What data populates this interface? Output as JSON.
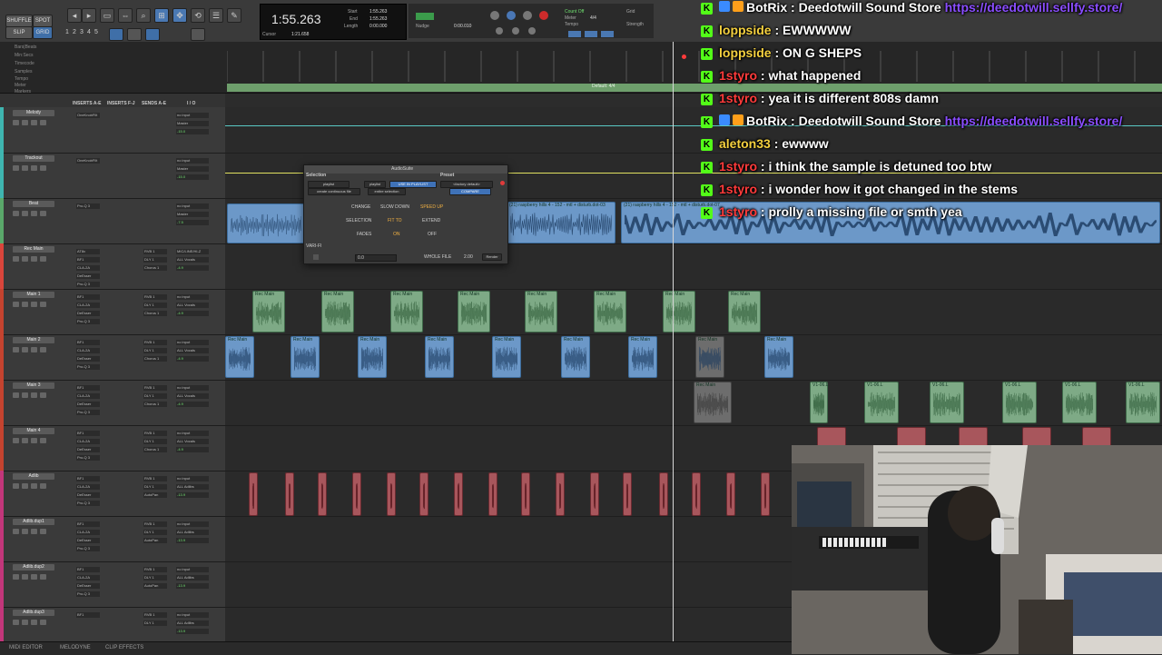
{
  "toolbar": {
    "mode_buttons": [
      "SHUFFLE",
      "SPOT",
      "SLIP",
      "GRID"
    ],
    "number_keys": [
      "1",
      "2",
      "3",
      "4",
      "5"
    ],
    "counter_main": "1:55.263",
    "counter_labels": [
      "Start",
      "End",
      "Length"
    ],
    "counter_values": [
      "1:55.263",
      "1:55.263",
      "0:00.000"
    ],
    "cursor_label": "Cursor",
    "cursor_value": "1:21.658",
    "nudge_label": "Nudge",
    "nudge_value": "0:00.010",
    "count_off_label": "Count Off",
    "meter_label": "Meter",
    "meter_value": "4/4",
    "tempo_label": "Tempo",
    "grid_label": "Grid",
    "strength_label": "Strength"
  },
  "rulers": {
    "labels": [
      "Bars|Beats",
      "Min:Secs",
      "Timecode",
      "Samples",
      "Tempo",
      "Meter",
      "Markers"
    ],
    "tempo_text": "Default: 4/4"
  },
  "mix_header": {
    "inserts_ae": "INSERTS A-E",
    "inserts_fj": "INSERTS F-J",
    "sends_ae": "SENDS A-E",
    "io": "I / O"
  },
  "tracks": [
    {
      "name": "Melody",
      "color": "#3fb5b0",
      "inserts": [
        "OneKnobFilt"
      ],
      "sends": [],
      "io": [
        "no input",
        "Master"
      ],
      "vol": "-15.0"
    },
    {
      "name": "Trackout",
      "color": "#3fb5b0",
      "inserts": [
        "OneKnobFilt"
      ],
      "sends": [],
      "io": [
        "no input",
        "Master"
      ],
      "vol": "-15.0"
    },
    {
      "name": "Beat",
      "color": "#5aa86a",
      "inserts": [
        "Pro-Q 3"
      ],
      "sends": [],
      "io": [
        "no input",
        "Master"
      ],
      "vol": "-7.5"
    },
    {
      "name": "Rec Main",
      "color": "#d9453b",
      "inserts": [
        "AT8x",
        "BF1",
        "CLA-2A",
        "DeEsser",
        "Pro-Q 3"
      ],
      "sends": [
        "RVB 1",
        "DLY 1",
        "Chorus 1"
      ],
      "io": [
        "MIC/LINE/HI-Z",
        "ALL Vocals"
      ],
      "vol": "-4.9"
    },
    {
      "name": "Main 1",
      "color": "#c4432f",
      "inserts": [
        "BF1",
        "CLA-2A",
        "DeEsser",
        "Pro-Q 3"
      ],
      "sends": [
        "RVB 1",
        "DLY 1",
        "Chorus 1"
      ],
      "io": [
        "no input",
        "ALL Vocals"
      ],
      "vol": "-4.9"
    },
    {
      "name": "Main 2",
      "color": "#c4432f",
      "inserts": [
        "BF1",
        "CLA-2A",
        "DeEsser",
        "Pro-Q 3"
      ],
      "sends": [
        "RVB 1",
        "DLY 1",
        "Chorus 1"
      ],
      "io": [
        "no input",
        "ALL Vocals"
      ],
      "vol": "-4.9"
    },
    {
      "name": "Main 3",
      "color": "#c4432f",
      "inserts": [
        "BF1",
        "CLA-2A",
        "DeEsser",
        "Pro-Q 3"
      ],
      "sends": [
        "RVB 1",
        "DLY 1",
        "Chorus 1"
      ],
      "io": [
        "no input",
        "ALL Vocals"
      ],
      "vol": "-4.9"
    },
    {
      "name": "Main 4",
      "color": "#c4432f",
      "inserts": [
        "BF1",
        "CLA-2A",
        "DeEsser",
        "Pro-Q 3"
      ],
      "sends": [
        "RVB 1",
        "DLY 1",
        "Chorus 1"
      ],
      "io": [
        "no input",
        "ALL Vocals"
      ],
      "vol": "-4.9"
    },
    {
      "name": "Adlib",
      "color": "#c2367a",
      "inserts": [
        "BF1",
        "CLA-2A",
        "DeEsser",
        "Pro-Q 3"
      ],
      "sends": [
        "RVB 1",
        "DLY 1",
        "AutoPan"
      ],
      "io": [
        "no input",
        "ALL Adlibs"
      ],
      "vol": "-13.9"
    },
    {
      "name": "Adlib.dup1",
      "color": "#c2367a",
      "inserts": [
        "BF1",
        "CLA-2A",
        "DeEsser",
        "Pro-Q 3"
      ],
      "sends": [
        "RVB 1",
        "DLY 1",
        "AutoPan"
      ],
      "io": [
        "no input",
        "ALL Adlibs"
      ],
      "vol": "-13.9"
    },
    {
      "name": "Adlib.dup2",
      "color": "#c2367a",
      "inserts": [
        "BF1",
        "CLA-2A",
        "DeEsser",
        "Pro-Q 3"
      ],
      "sends": [
        "RVB 1",
        "DLY 1",
        "AutoPan"
      ],
      "io": [
        "no input",
        "ALL Adlibs"
      ],
      "vol": "-13.9"
    },
    {
      "name": "Adlib.dup3",
      "color": "#c2367a",
      "inserts": [
        "BF1"
      ],
      "sends": [
        "RVB 1",
        "DLY 1"
      ],
      "io": [
        "no input",
        "ALL Adlibs"
      ],
      "vol": "-13.9"
    }
  ],
  "clips": {
    "beat_clip_1": "(21) raspberry hills 4 - 152 - mtl + disturb.dot-03",
    "beat_clip_2": "(21) raspberry hills 4 - 152 - mtl + disturb.dot-07",
    "rec_main_clip": "Rec Main",
    "rec_main_db": "0 dB",
    "vocal_short": "V1-06.L",
    "vocal_gain": "+32.0 dB"
  },
  "plugin": {
    "title": "AudioSuite",
    "selection_label": "Selection",
    "preset_label": "Preset",
    "playlist_label": "playlist",
    "use_in_playlist": "USE IN PLAYLIST",
    "create_continuous": "create continuous file",
    "entire_selection": "entire selection",
    "factory_default": "<factory default>",
    "compare": "COMPARE",
    "change_label": "CHANGE",
    "slow_down": "SLOW DOWN",
    "speed_up": "SPEED UP",
    "selection_row": "SELECTION",
    "fit_to": "FIT TO",
    "extend": "EXTEND",
    "fades_label": "FADES",
    "fades_on": "ON",
    "fades_off": "OFF",
    "plugin_name": "VARI-FI",
    "value": "0.0",
    "whole_file": "WHOLE FILE",
    "value2": "2.00",
    "render": "Render"
  },
  "bottom": {
    "left": "MIDI EDITOR",
    "mid": "MELODYNE",
    "right": "CLIP EFFECTS"
  },
  "chat": [
    {
      "user": "BotRix",
      "user_color": "#ffffff",
      "bot": true,
      "message": "Deedotwill Sound Store",
      "link": "https://deedotwill.sellfy.store/"
    },
    {
      "user": "loppside",
      "user_color": "#f4d03f",
      "bot": false,
      "message": "EWWWWW",
      "link": ""
    },
    {
      "user": "loppside",
      "user_color": "#f4d03f",
      "bot": false,
      "message": "ON G SHEPS",
      "link": ""
    },
    {
      "user": "1styro",
      "user_color": "#ff3b3b",
      "bot": false,
      "message": "what happened",
      "link": ""
    },
    {
      "user": "1styro",
      "user_color": "#ff3b3b",
      "bot": false,
      "message": "yea it is different 808s damn",
      "link": ""
    },
    {
      "user": "BotRix",
      "user_color": "#ffffff",
      "bot": true,
      "message": "Deedotwill Sound Store",
      "link": "https://deedotwill.sellfy.store/"
    },
    {
      "user": "aleton33",
      "user_color": "#f4d03f",
      "bot": false,
      "message": "ewwww",
      "link": ""
    },
    {
      "user": "1styro",
      "user_color": "#ff3b3b",
      "bot": false,
      "message": "i think the sample is detuned too btw",
      "link": ""
    },
    {
      "user": "1styro",
      "user_color": "#ff3b3b",
      "bot": false,
      "message": "i wonder how it got changed in the stems",
      "link": ""
    },
    {
      "user": "1styro",
      "user_color": "#ff3b3b",
      "bot": false,
      "message": "prolly a missing file or smth yea",
      "link": ""
    }
  ],
  "colors": {
    "kick_badge": "#53fc18",
    "link": "#8a4dff",
    "clip_green": "#7eaa86",
    "clip_blue": "#6c98c8",
    "tempo_green": "#6e9f6c"
  }
}
